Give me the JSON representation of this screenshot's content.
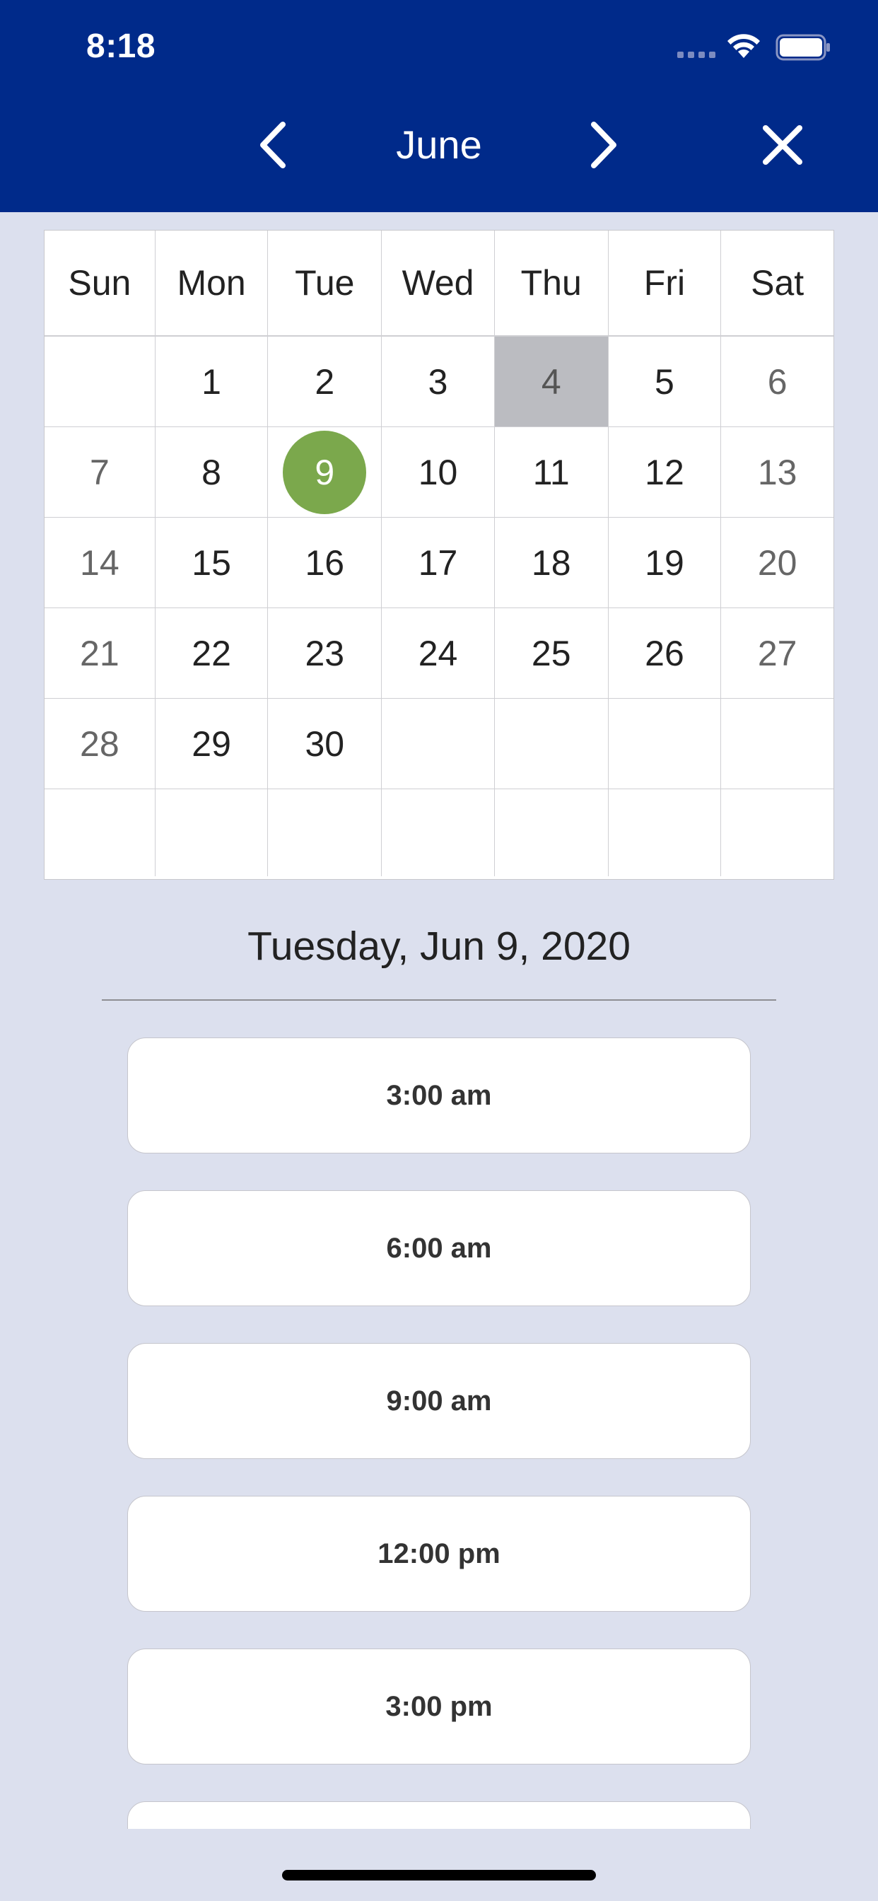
{
  "status_bar": {
    "time": "8:18"
  },
  "header": {
    "month": "June",
    "prev_icon": "chevron-left-icon",
    "next_icon": "chevron-right-icon",
    "close_icon": "close-icon"
  },
  "calendar": {
    "weekdays": [
      "Sun",
      "Mon",
      "Tue",
      "Wed",
      "Thu",
      "Fri",
      "Sat"
    ],
    "weeks": [
      [
        "",
        "1",
        "2",
        "3",
        "4",
        "5",
        "6"
      ],
      [
        "7",
        "8",
        "9",
        "10",
        "11",
        "12",
        "13"
      ],
      [
        "14",
        "15",
        "16",
        "17",
        "18",
        "19",
        "20"
      ],
      [
        "21",
        "22",
        "23",
        "24",
        "25",
        "26",
        "27"
      ],
      [
        "28",
        "29",
        "30",
        "",
        "",
        "",
        ""
      ],
      [
        "",
        "",
        "",
        "",
        "",
        "",
        ""
      ]
    ],
    "today": "4",
    "selected": "9"
  },
  "selected_date_label": "Tuesday, Jun 9, 2020",
  "time_slots": [
    "3:00 am",
    "6:00 am",
    "9:00 am",
    "12:00 pm",
    "3:00 pm",
    ""
  ],
  "colors": {
    "header": "#002a8a",
    "background": "#dce0ee",
    "selected": "#7ba84c",
    "today": "#bbbcc1"
  }
}
